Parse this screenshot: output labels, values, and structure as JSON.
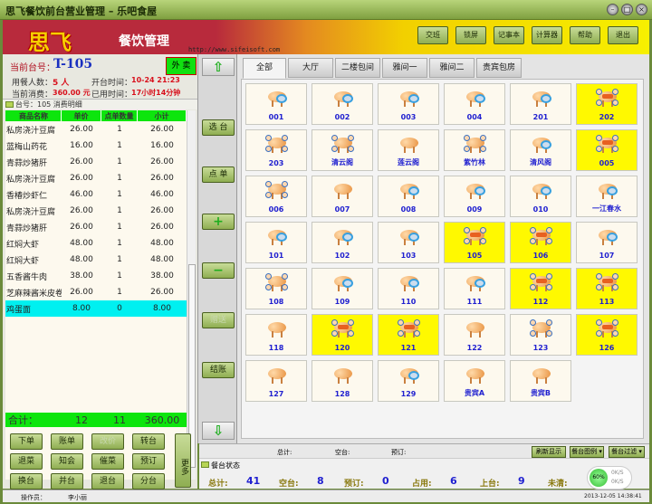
{
  "window": {
    "title": "思飞餐饮前台营业管理 – 乐吧食屋",
    "min": "–",
    "max": "□",
    "close": "×"
  },
  "header": {
    "logo": "思飞",
    "app_title": "餐饮管理",
    "url": "http://www.sifeisoft.com",
    "buttons": [
      "交班",
      "锁屏",
      "记事本",
      "计算器",
      "帮助",
      "退出"
    ]
  },
  "info": {
    "table_label": "当前台号：",
    "table_no": "T-105",
    "takeout": "外 卖",
    "guests_label": "用餐人数：",
    "guests": "5 人",
    "open_label": "开台时间：",
    "open_time": "10-24 21:23",
    "spent_label": "当前消费：",
    "spent": "360.00 元",
    "used_label": "已用时间：",
    "used_time": "17小时14分钟"
  },
  "order": {
    "section_title": "台号：105  消费明细",
    "columns": [
      "商品名称",
      "单价",
      "点单数量",
      "小计"
    ],
    "rows": [
      [
        "私房浇汁豆腐",
        "26.00",
        "1",
        "26.00"
      ],
      [
        "蓝梅山药花",
        "16.00",
        "1",
        "16.00"
      ],
      [
        "青蒜炒猪肝",
        "26.00",
        "1",
        "26.00"
      ],
      [
        "私房浇汁豆腐",
        "26.00",
        "1",
        "26.00"
      ],
      [
        "香椿炒虾仁",
        "46.00",
        "1",
        "46.00"
      ],
      [
        "私房浇汁豆腐",
        "26.00",
        "1",
        "26.00"
      ],
      [
        "青蒜炒猪肝",
        "26.00",
        "1",
        "26.00"
      ],
      [
        "红焖大虾",
        "48.00",
        "1",
        "48.00"
      ],
      [
        "红焖大虾",
        "48.00",
        "1",
        "48.00"
      ],
      [
        "五香酱牛肉",
        "38.00",
        "1",
        "38.00"
      ],
      [
        "芝麻辣酱米皮卷",
        "26.00",
        "1",
        "26.00"
      ],
      [
        "鸡蛋面",
        "8.00",
        "0",
        "8.00"
      ]
    ],
    "total_label": "合计：",
    "total_qty": "12",
    "total_count": "11",
    "total_amount": "360.00"
  },
  "actions": [
    [
      "下单",
      "账单",
      "改价",
      "转台"
    ],
    [
      "退菜",
      "知会",
      "催菜",
      "预订"
    ],
    [
      "换台",
      "并台",
      "退台",
      "分台"
    ]
  ],
  "more": "更多",
  "middle": {
    "select": "选 台",
    "order": "点 单",
    "plus": "+",
    "minus": "−",
    "gift": "赠送",
    "checkout": "结账",
    "up": "⇧",
    "down": "⇩"
  },
  "tabs": [
    "全部",
    "大厅",
    "二楼包间",
    "雅间一",
    "雅间二",
    "贵宾包房"
  ],
  "tables": [
    [
      "001",
      "dirty"
    ],
    [
      "002",
      "dirty"
    ],
    [
      "003",
      "dirty"
    ],
    [
      "004",
      "dirty"
    ],
    [
      "201",
      "dirty"
    ],
    [
      "202",
      "occupied"
    ],
    [
      "203",
      "seated"
    ],
    [
      "清云阁",
      "seated"
    ],
    [
      "莲云阁",
      "empty"
    ],
    [
      "紫竹林",
      "seated"
    ],
    [
      "清风阁",
      "dirty"
    ],
    [
      "005",
      "occupied"
    ],
    [
      "006",
      "seated"
    ],
    [
      "007",
      "empty"
    ],
    [
      "008",
      "dirty"
    ],
    [
      "009",
      "dirty"
    ],
    [
      "010",
      "dirty"
    ],
    [
      "一江春水",
      "dirty"
    ],
    [
      "101",
      "dirty"
    ],
    [
      "102",
      "dirty"
    ],
    [
      "103",
      "dirty"
    ],
    [
      "105",
      "occupied"
    ],
    [
      "106",
      "occupied"
    ],
    [
      "107",
      "dirty"
    ],
    [
      "108",
      "seated"
    ],
    [
      "109",
      "dirty"
    ],
    [
      "110",
      "dirty"
    ],
    [
      "111",
      "dirty"
    ],
    [
      "112",
      "occupied"
    ],
    [
      "113",
      "occupied"
    ],
    [
      "118",
      "empty"
    ],
    [
      "120",
      "occupied"
    ],
    [
      "121",
      "occupied"
    ],
    [
      "122",
      "empty"
    ],
    [
      "123",
      "seated"
    ],
    [
      "126",
      "occupied"
    ],
    [
      "127",
      "empty"
    ],
    [
      "128",
      "empty"
    ],
    [
      "129",
      "dirty"
    ],
    [
      "贵宾A",
      "empty"
    ],
    [
      "贵宾B",
      "empty"
    ]
  ],
  "summary_bar": {
    "total": "总计:",
    "empty": "空台:",
    "reserved": "预订:",
    "refresh": "刷新显示",
    "legend": "餐台图例 ▾",
    "filter": "餐台过滤 ▾"
  },
  "status": {
    "title": "餐台状态",
    "items": [
      [
        "总计:",
        "41"
      ],
      [
        "空台:",
        "8"
      ],
      [
        "预订:",
        "0"
      ],
      [
        "占用:",
        "6"
      ],
      [
        "上台:",
        "9"
      ],
      [
        "未清:",
        ""
      ]
    ],
    "net_percent": "60%",
    "up_rate": "0K/S",
    "down_rate": "0K/S"
  },
  "statusbar": {
    "operator_label": "操作员：",
    "operator": "李小丽",
    "datetime": "2013-12-05 14:38:41"
  },
  "colors": {
    "occupied": "#fff900",
    "accent_green": "#0de50d",
    "selected_row": "#00f0f0"
  }
}
